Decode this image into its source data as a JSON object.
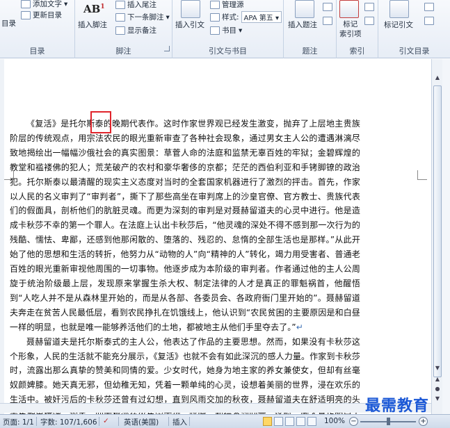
{
  "ribbon": {
    "toc_group": {
      "button": "目录",
      "add_text": "添加文字",
      "update_toc": "更新目录",
      "label": "目录"
    },
    "footnote_group": {
      "insert_footnote": "插入脚注",
      "insert_endnote": "插入尾注",
      "next_footnote": "下一条脚注",
      "show_notes": "显示备注",
      "label": "脚注"
    },
    "citation_group": {
      "insert_citation": "插入引文",
      "manage_sources": "管理源",
      "style_label": "样式:",
      "style_value": "APA 第五",
      "bibliography": "书目",
      "label": "引文与书目"
    },
    "caption_group": {
      "insert_caption": "插入题注",
      "label": "题注"
    },
    "index_group": {
      "mark_entry": "标记\n索引项",
      "label": "索引"
    },
    "authorities_group": {
      "mark_citation": "标记引文",
      "label": "引文目录"
    }
  },
  "document": {
    "paragraphs": [
      "《复活》是托尔斯泰的晚期代表作。这时作家世界观已经发生激变，抛弃了上层地主贵族阶层的传统观点，用宗法农民的眼光重新审查了各种社会现象，通过男女主人公的遭遇淋漓尽致地揭绘出一幅幅沙俄社会的真实图景：草菅人命的法庭和监禁无辜百姓的牢狱；金碧辉煌的教堂和褴褛佛的犯人；荒芜破产的农村和豪华奢侈的京都；茫茫的西伯利亚和手铐脚镣的政治犯。托尔斯泰以最清醒的现实主义态度对当时的全套国家机器进行了激烈的抨击。首先，作家以人民的名义审判了“审判者”，撕下了那些高坐在审判席上的沙皇官僚、官方教士、贵族代表们的假面具，剖析他们的肮脏灵魂。而更为深刻的审判是对聂赫留道夫的心灵中进行。他是造成卡秋莎不幸的第一个罪人。在法庭上认出卡秋莎后，“他灵魂的深处不得不感到那一次行为的残酷、懦怯、卑鄙，还感到他那闲散的、堕落的、残忍的、怠惰的全部生活也是那样。”从此开始了他的思想和生活的转折，他努力从“动物的人”向“精神的人”转化，竭力用受害者、普通老百姓的眼光重新审视他周围的一切事物。他逐步成为本阶级的审判者。作者通过他的主人公周旋于统治阶级最上层，发现原来掌握生杀大权、制定法律的人才是真正的罪魁祸首，他醒悟到“人吃人并不是从森林里开始的，而是从各部、各委员会、各政府衙门里开始的”。聂赫留道夫奔走在贫苦人民最低层，看到农民挣扎在饥饿线上，他认识到“农民贫困的主要原因是和白昼一样的明显，也就是唯一能够养活他们的土地，都被地主从他们手里夺去了。”",
      "聂赫留道夫是托尔斯泰式的主人公，他表达了作品的主要思想。然而，如果没有卡秋莎这个形象，人民的生活就不能充分展示，《复活》也就不会有如此深沉的感人力量。作家到卡秋莎时，流露出那么真挚的赞美和同情的爱。少女时代，她身为地主家的养女兼使女，但却有丝毫奴颜婢膝。她天真无邪，但幼稚无知，凭着一颗单纯的心灵，设想着美丽的世界，浸在欢乐的生活中。被奸污后的卡秋莎还曾有过幻想，直到风雨交加的秋夜，聂赫留道夫在舒适明亮的头等车厢里玩牌、谈笑，而卡秋莎在火车旁奔跑、呼喊，却得不到回音，这时，她才真正明白了自己的真实处境，意识到她在社会上的地位，从此对一切都失去了信心，走上了堕落的道路。"
    ],
    "paragraph_mark": "↵"
  },
  "watermark": "最需教育",
  "statusbar": {
    "page": "页面: 1/1",
    "words": "字数: 107/1,606",
    "language": "英语(美国)",
    "mode": "插入",
    "zoom": "100%",
    "zoom_minus": "−",
    "zoom_plus": "+"
  }
}
